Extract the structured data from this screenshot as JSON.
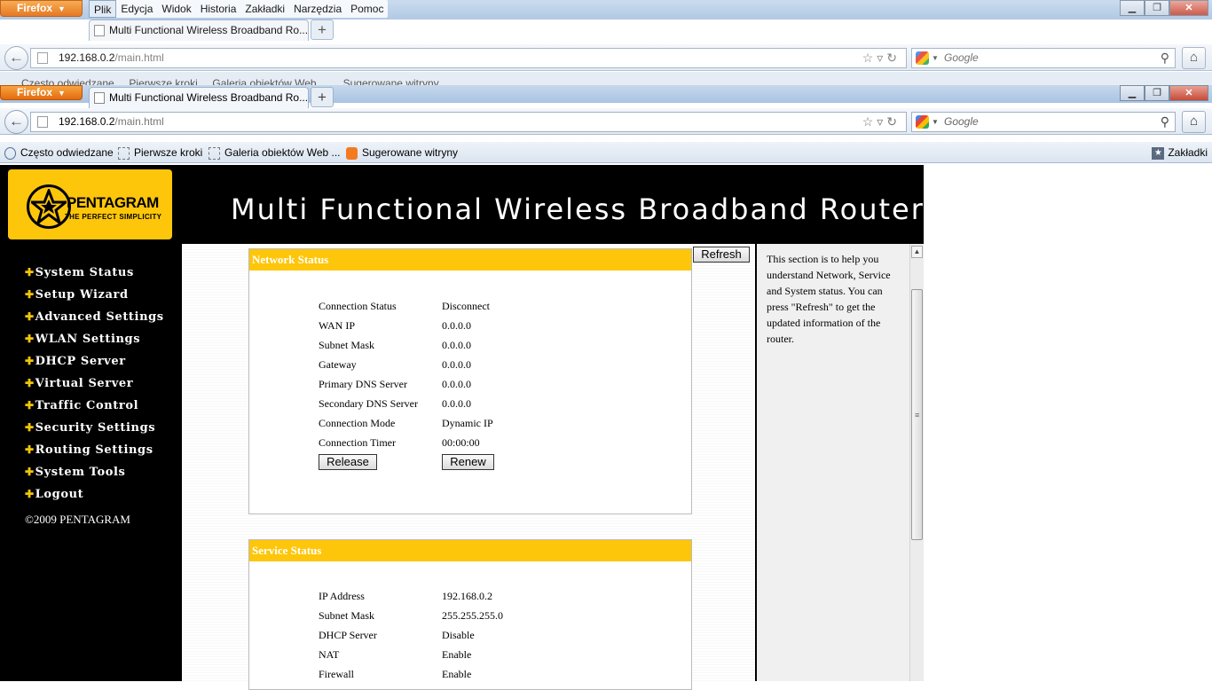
{
  "browser": {
    "firefox_label": "Firefox",
    "menu": [
      "Plik",
      "Edycja",
      "Widok",
      "Historia",
      "Zakładki",
      "Narzędzia",
      "Pomoc"
    ],
    "tab_title": "Multi Functional Wireless Broadband Ro...",
    "url_host": "192.168.0.2",
    "url_path": "/main.html",
    "search_placeholder": "Google",
    "bookmarks": [
      "Często odwiedzane",
      "Pierwsze kroki",
      "Galeria obiektów Web ...",
      "Sugerowane witryny"
    ],
    "bookmarks_right": "Zakładki",
    "ghost_bookmarks": "Często odwiedzane     Pierwsze kroki     Galeria obiektów Web ...     Sugerowane witryny"
  },
  "router": {
    "brand": "PENTAGRAM",
    "tagline": "THE PERFECT SIMPLICITY",
    "title": "Multi Functional Wireless Broadband Router",
    "nav": [
      "System Status",
      "Setup Wizard",
      "Advanced Settings",
      "WLAN Settings",
      "DHCP Server",
      "Virtual Server",
      "Traffic Control",
      "Security Settings",
      "Routing Settings",
      "System Tools",
      "Logout"
    ],
    "copyright": "©2009 PENTAGRAM",
    "refresh_label": "Refresh",
    "network_status": {
      "heading": "Network Status",
      "rows": [
        {
          "label": "Connection Status",
          "value": "Disconnect"
        },
        {
          "label": "WAN IP",
          "value": "0.0.0.0"
        },
        {
          "label": "Subnet Mask",
          "value": "0.0.0.0"
        },
        {
          "label": "Gateway",
          "value": "0.0.0.0"
        },
        {
          "label": "Primary DNS Server",
          "value": "0.0.0.0"
        },
        {
          "label": "Secondary DNS Server",
          "value": "0.0.0.0"
        },
        {
          "label": "Connection Mode",
          "value": "Dynamic IP"
        },
        {
          "label": "Connection Timer",
          "value": "00:00:00"
        }
      ],
      "release_label": "Release",
      "renew_label": "Renew"
    },
    "service_status": {
      "heading": "Service Status",
      "rows": [
        {
          "label": "IP Address",
          "value": "192.168.0.2"
        },
        {
          "label": "Subnet Mask",
          "value": "255.255.255.0"
        },
        {
          "label": "DHCP Server",
          "value": "Disable"
        },
        {
          "label": "NAT",
          "value": "Enable"
        },
        {
          "label": "Firewall",
          "value": "Enable"
        }
      ]
    },
    "help_text": "This section is to help you understand Network, Service and System status. You can press \"Refresh\" to get the updated information of the router."
  }
}
